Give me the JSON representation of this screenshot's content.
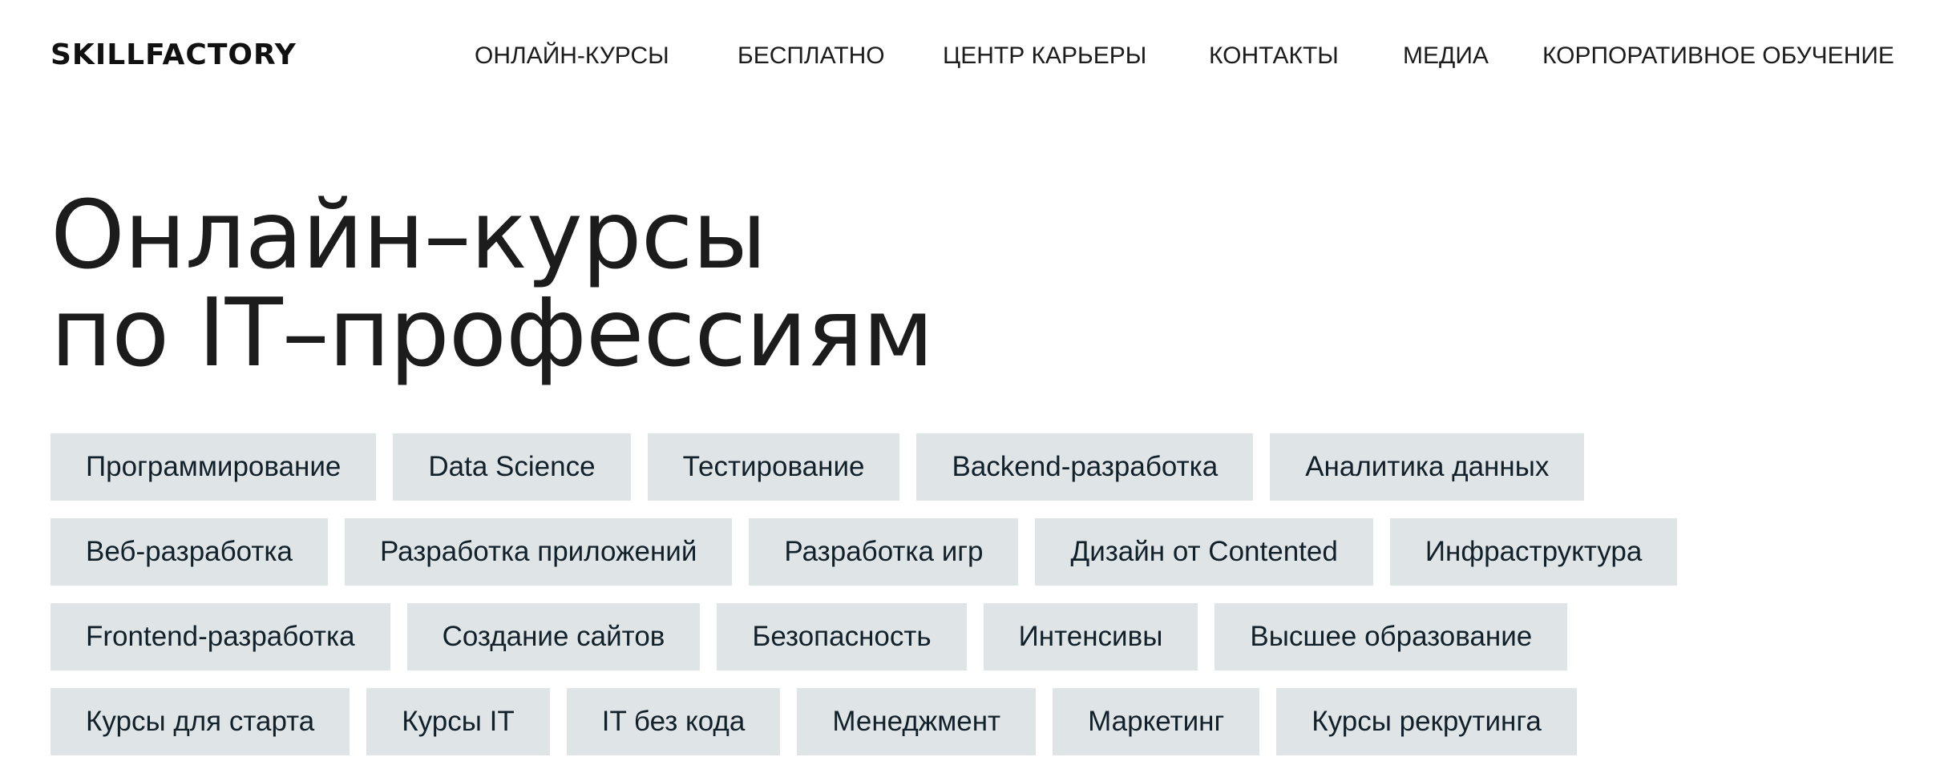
{
  "header": {
    "logo": "SKILLFACTORY",
    "nav": [
      "ОНЛАЙН-КУРСЫ",
      "БЕСПЛАТНО",
      "ЦЕНТР КАРЬЕРЫ",
      "КОНТАКТЫ",
      "МЕДИА",
      "КОРПОРАТИВНОЕ ОБУЧЕНИЕ"
    ]
  },
  "hero": {
    "title_line1": "Онлайн–курсы",
    "title_line2": "по IT–профессиям"
  },
  "tags": {
    "row1": [
      "Программирование",
      "Data Science",
      "Тестирование",
      "Backend-разработка",
      "Аналитика данных"
    ],
    "row2": [
      "Веб-разработка",
      "Разработка приложений",
      "Разработка игр",
      "Дизайн от Contented",
      "Инфраструктура"
    ],
    "row3": [
      "Frontend-разработка",
      "Создание сайтов",
      "Безопасность",
      "Интенсивы",
      "Высшее образование"
    ],
    "row4": [
      "Курсы для старта",
      "Курсы IT",
      "IT без кода",
      "Менеджмент",
      "Маркетинг",
      "Курсы рекрутинга"
    ]
  },
  "colors": {
    "tag_background": "#dfe5e7",
    "text": "#1c1c1c",
    "tag_text": "#12202a"
  }
}
